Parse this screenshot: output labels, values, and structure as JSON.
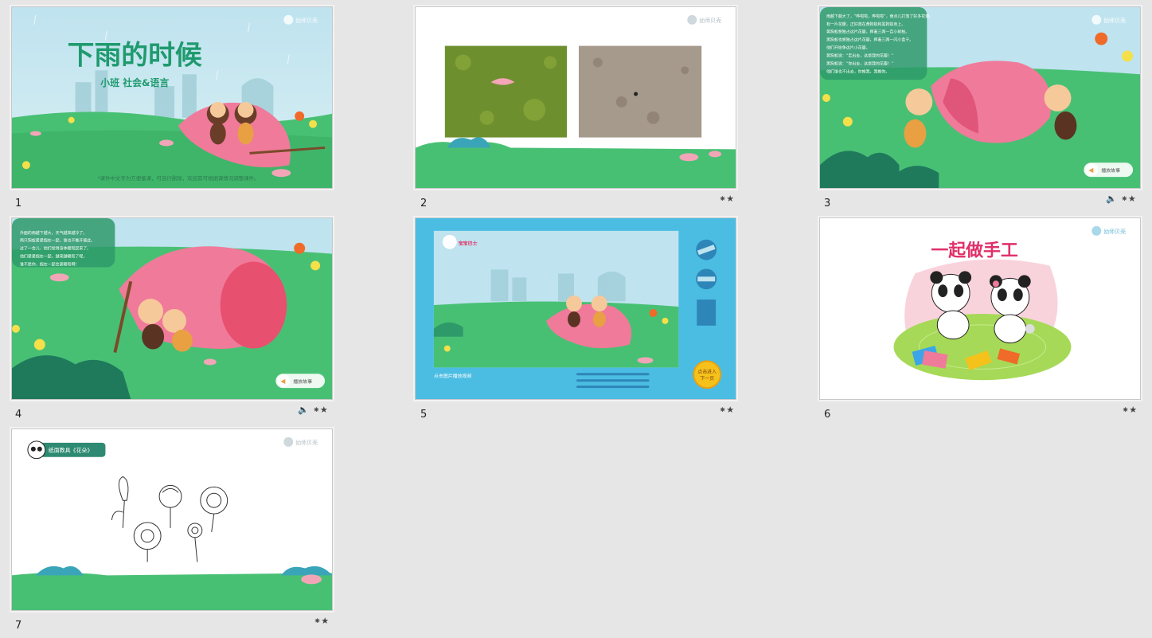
{
  "slides": [
    {
      "number": "1",
      "title": "下雨的时候",
      "subtitle": "小班 社会&语言",
      "note": "*课件中文字为方便备课，可自行删除，欢迎其可根据课情况调整课件。",
      "logo": "幼师贝壳",
      "has_audio": false,
      "has_anim": false
    },
    {
      "number": "2",
      "logo": "幼师贝壳",
      "has_audio": false,
      "has_anim": true
    },
    {
      "number": "3",
      "logo": "幼师贝壳",
      "text_lines": [
        "雨越下越大了，“哗啦啦，哗啦啦”，雨点儿打落了好多花瓣。",
        "有一片花瓣，正好落在黄狗蚁和黑狗蚁身上。",
        "黄狗蚁想独占这片花瓣，挥着三两一百小树枝。",
        "黑狗蚁也想独占这片花瓣，挥着三两一闪小盒子。",
        "他们开始争这片小花瓣。",
        "黄狗蚁说：“走出去，这是我的花瓣！”",
        "黑狗蚁说：“你出去，这是我的花瓣！”",
        "他们谁也不出去，你推我，我推你。"
      ],
      "play_label": "播放故事",
      "has_audio": true,
      "has_anim": true
    },
    {
      "number": "4",
      "text_lines": [
        "外面的雨越下越大，天气越来越冷了。",
        "两只狗蚁紧紧抱在一起，谁也不推开彼此。",
        "过了一会儿，他们觉得身体暖和起来了。",
        "他们紧紧抱在一起，越来越暖和了呢，",
        "谁不愿你，抱在一起会更暖和啊！"
      ],
      "play_label": "播放故事",
      "has_audio": true,
      "has_anim": true
    },
    {
      "number": "5",
      "caption": "点击图片播放视频",
      "button_label_1": "点击进入",
      "button_label_2": "下一页",
      "video_logo": "宝宝巴士",
      "has_audio": false,
      "has_anim": true
    },
    {
      "number": "6",
      "title": "一起做手工",
      "logo": "幼师贝壳",
      "has_audio": false,
      "has_anim": true
    },
    {
      "number": "7",
      "tag": "纸面教具《花朵》",
      "logo": "幼师贝壳",
      "has_audio": false,
      "has_anim": true
    }
  ],
  "icons": {
    "audio": "speaker-icon",
    "animation": "star-animation-icon"
  },
  "colors": {
    "background": "#e6e6e6",
    "grass": "#3fbf6f",
    "petal": "#f07a9a",
    "title_green": "#1f9a6e",
    "panel_blue": "#4bbde3",
    "button_yellow": "#f5c21b"
  }
}
